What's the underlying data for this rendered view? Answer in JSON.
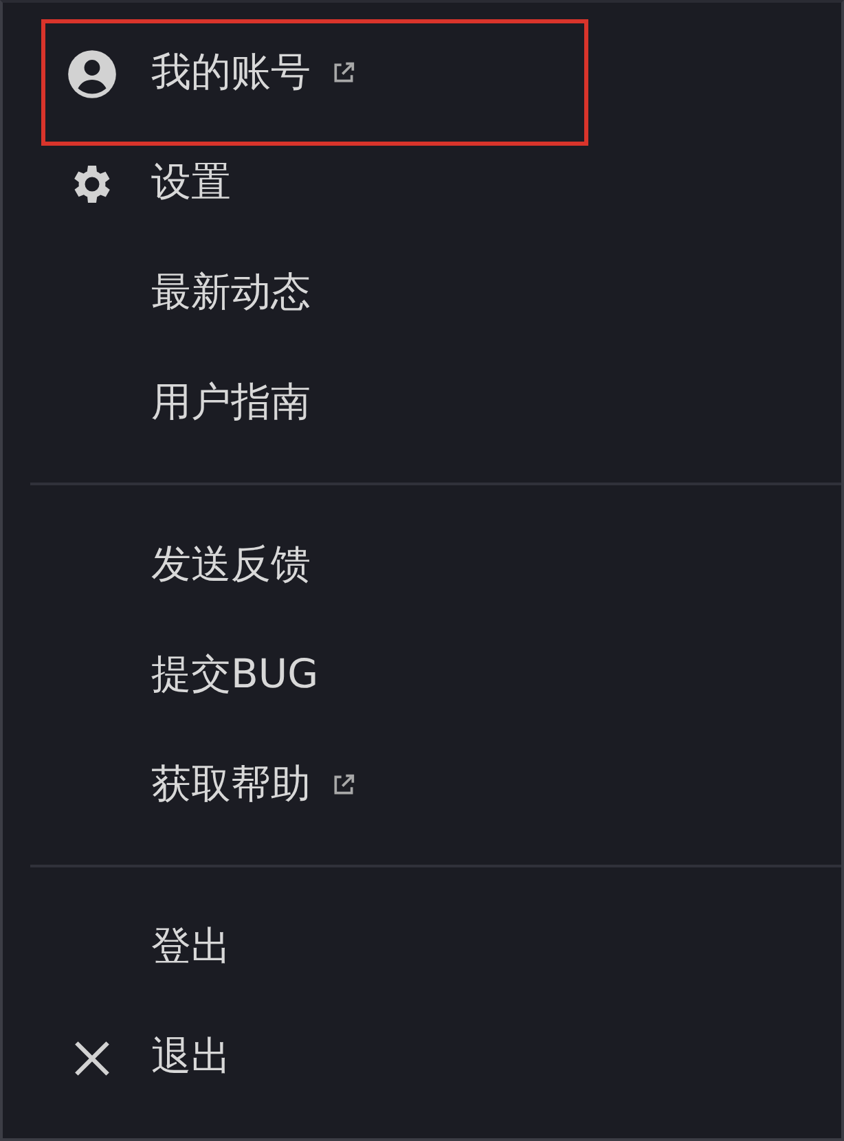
{
  "menu": {
    "groups": [
      {
        "items": [
          {
            "label": "我的账号",
            "kind": "account",
            "external": true,
            "highlighted": true
          },
          {
            "label": "设置",
            "kind": "gear",
            "external": false,
            "highlighted": false
          },
          {
            "label": "最新动态",
            "kind": "plain",
            "external": false,
            "highlighted": false
          },
          {
            "label": "用户指南",
            "kind": "plain",
            "external": false,
            "highlighted": false
          }
        ]
      },
      {
        "items": [
          {
            "label": "发送反馈",
            "kind": "plain",
            "external": false,
            "highlighted": false
          },
          {
            "label": "提交BUG",
            "kind": "plain",
            "external": false,
            "highlighted": false
          },
          {
            "label": "获取帮助",
            "kind": "plain",
            "external": true,
            "highlighted": false
          }
        ]
      },
      {
        "items": [
          {
            "label": "登出",
            "kind": "plain",
            "external": false,
            "highlighted": false
          },
          {
            "label": "退出",
            "kind": "close",
            "external": false,
            "highlighted": false
          }
        ]
      }
    ]
  }
}
